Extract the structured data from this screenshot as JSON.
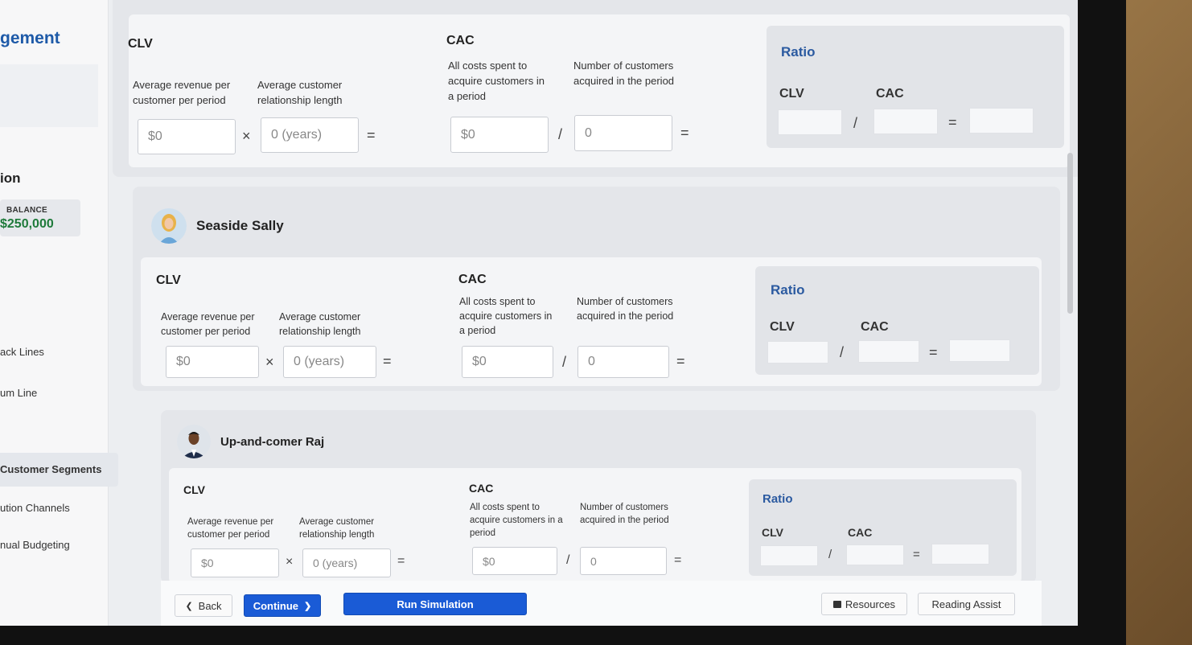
{
  "sidebar": {
    "title": "gement",
    "section": "ion",
    "balance_label": "BALANCE",
    "balance_value": "$250,000",
    "nav": [
      "ack Lines",
      "um Line",
      "Customer Segments",
      "ution Channels",
      "nual Budgeting"
    ]
  },
  "labels": {
    "clv": "CLV",
    "cac": "CAC",
    "ratio": "Ratio",
    "avg_revenue": "Average revenue per customer per period",
    "avg_length": "Average customer relationship length",
    "all_costs": "All costs spent to acquire customers in a period",
    "num_customers": "Number of customers acquired in the period",
    "times": "×",
    "divide": "/",
    "equals": "="
  },
  "segments": [
    {
      "name": "",
      "revenue": "$0",
      "length": "0 (years)",
      "costs": "$0",
      "count": "0"
    },
    {
      "name": "Seaside Sally",
      "revenue": "$0",
      "length": "0 (years)",
      "costs": "$0",
      "count": "0"
    },
    {
      "name": "Up-and-comer Raj",
      "revenue": "$0",
      "length": "0 (years)",
      "costs": "$0",
      "count": "0"
    }
  ],
  "footer": {
    "back": "Back",
    "continue": "Continue",
    "run": "Run Simulation",
    "resources": "Resources",
    "reading_assist": "Reading Assist"
  },
  "colors": {
    "primary": "#1a5bd6",
    "ratio_title": "#2b5aa0",
    "balance": "#1e7a3a"
  }
}
